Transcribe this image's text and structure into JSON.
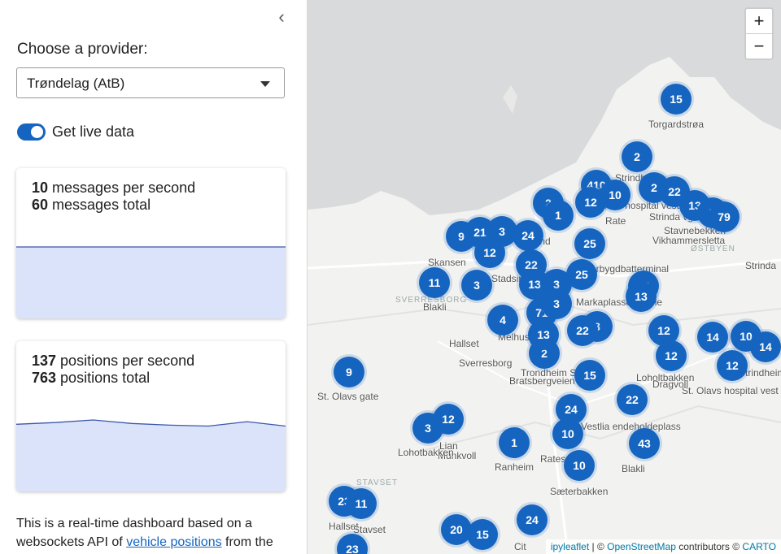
{
  "sidebar": {
    "collapse_icon": "chevron-left",
    "provider_label": "Choose a provider:",
    "provider_selected": "Trøndelag (AtB)",
    "live_label": "Get live data",
    "live_on": true,
    "messages_card": {
      "rate_value": "10",
      "rate_label": " messages per second",
      "total_value": "60",
      "total_label": " messages total",
      "series": [
        10,
        10,
        10,
        10,
        10,
        10,
        10,
        10
      ]
    },
    "positions_card": {
      "rate_value": "137",
      "rate_label": " positions per second",
      "total_value": "763",
      "total_label": " positions total",
      "series": [
        130,
        132,
        135,
        131,
        129,
        128,
        133,
        128
      ]
    },
    "description_before": "This is a real-time dashboard based on a websockets API of ",
    "description_link": "vehicle positions",
    "description_after": " from the"
  },
  "map": {
    "zoom_in": "+",
    "zoom_out": "−",
    "clusters": [
      "15",
      "2",
      "410",
      "10",
      "12",
      "2",
      "22",
      "13",
      "7",
      "79",
      "2",
      "1",
      "9",
      "21",
      "3",
      "24",
      "12",
      "25",
      "22",
      "13",
      "25",
      "11",
      "3",
      "13",
      "3",
      "71",
      "13",
      "3",
      "22",
      "12",
      "12",
      "14",
      "10",
      "14",
      "12",
      "9",
      "15",
      "24",
      "22",
      "3",
      "12",
      "10",
      "43",
      "1",
      "10",
      "24",
      "20",
      "15",
      "23",
      "23",
      "11",
      "2",
      "13",
      "3",
      "4"
    ],
    "places": [
      "Torgardstrøa",
      "Strindheim",
      "Rate",
      "Strinda vgs.",
      "Trondheim hospital vest",
      "Stavnebekken",
      "Vikhammersletta",
      "ØSTBYEN",
      "Strinda",
      "Trondheim S",
      "Lund",
      "Sorbygdbatterminal",
      "Skansen",
      "Stadsing",
      "SVERRESBORG",
      "Blakli",
      "Hallset",
      "Melhus",
      "Sverresborg",
      "Trondheim S",
      "Bratsbergveien",
      "Østre Dale",
      "Markaplassen skole",
      "Vestlia endeholdeplass",
      "Sorgarden",
      "Lian",
      "Munkvoll",
      "Lohotbakken",
      "Ranheim",
      "Rates",
      "Sæterbakken",
      "St. Olavs gate",
      "St. Olavs hospital vest",
      "Loholtbakken",
      "Dragvoll",
      "Strindheim",
      "Hallset",
      "Stavset",
      "STAVSET",
      "Vestlia endeholdeplass",
      "Rateshaugen",
      "Blakli",
      "Cit"
    ],
    "attribution": {
      "widget": "ipyleaflet",
      "sep": " | © ",
      "osm": "OpenStreetMap",
      "contrib": " contributors © ",
      "carto": "CARTO"
    }
  }
}
